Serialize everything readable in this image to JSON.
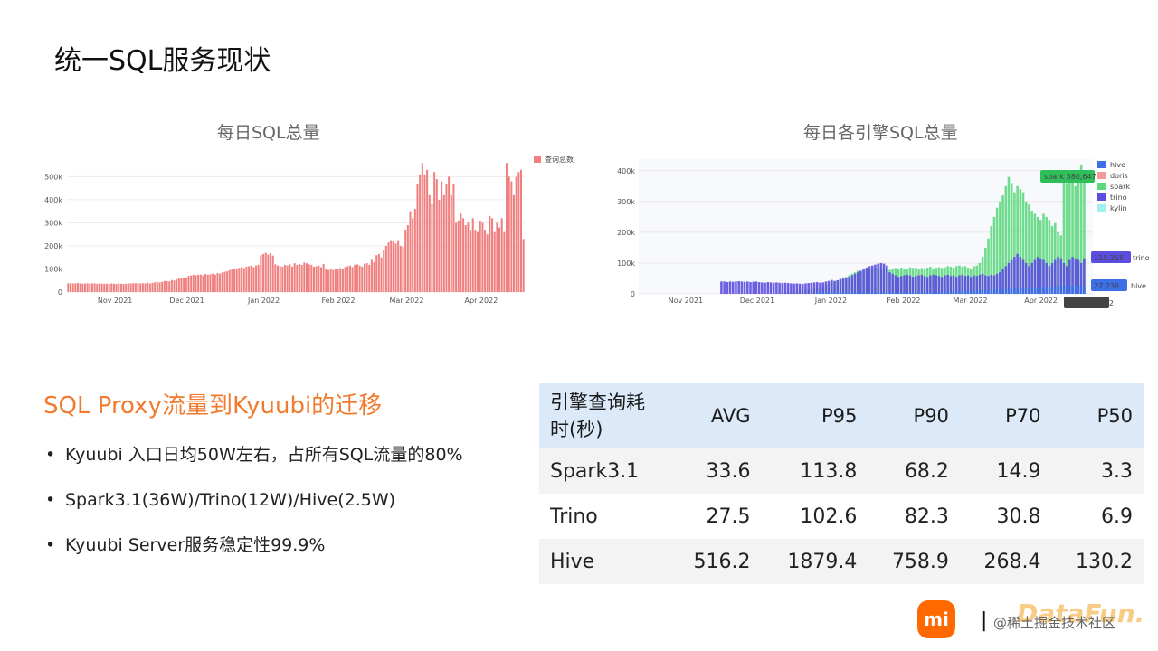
{
  "slide_title": "统一SQL服务现状",
  "chart_data": [
    {
      "type": "bar",
      "title": "每日SQL总量",
      "legend": [
        "查询总数"
      ],
      "legend_position": "top-right",
      "x_tick_labels": [
        "Nov 2021",
        "Dec 2021",
        "Jan 2022",
        "Feb 2022",
        "Mar 2022",
        "Apr 2022"
      ],
      "y_tick_labels": [
        "0",
        "100k",
        "200k",
        "300k",
        "400k",
        "500k"
      ],
      "ylim": [
        0,
        580000
      ],
      "colors": {
        "bars": "#f08080"
      },
      "series": [
        {
          "values": [
            38000,
            38000,
            37000,
            38000,
            39000,
            38000,
            36000,
            37000,
            38000,
            37000,
            37000,
            38000,
            36000,
            37000,
            37000,
            36000,
            36000,
            35000,
            37000,
            36000,
            35000,
            38000,
            36000,
            35000,
            36000,
            38000,
            37000,
            38000,
            38000,
            39000,
            37000,
            38000,
            38000,
            40000,
            37000,
            40000,
            42000,
            45000,
            42000,
            44000,
            48000,
            47000,
            46000,
            52000,
            50000,
            55000,
            60000,
            62000,
            60000,
            63000,
            70000,
            72000,
            75000,
            72000,
            75000,
            76000,
            72000,
            78000,
            75000,
            77000,
            80000,
            75000,
            82000,
            80000,
            85000,
            88000,
            90000,
            95000,
            97000,
            100000,
            102000,
            105000,
            108000,
            104000,
            110000,
            112000,
            115000,
            108000,
            115000,
            118000,
            160000,
            165000,
            170000,
            162000,
            168000,
            158000,
            120000,
            115000,
            112000,
            110000,
            118000,
            115000,
            120000,
            110000,
            125000,
            118000,
            122000,
            118000,
            128000,
            125000,
            120000,
            118000,
            110000,
            112000,
            115000,
            108000,
            122000,
            100000,
            95000,
            98000,
            96000,
            98000,
            100000,
            104000,
            100000,
            108000,
            112000,
            115000,
            108000,
            118000,
            120000,
            115000,
            110000,
            122000,
            125000,
            118000,
            140000,
            130000,
            160000,
            165000,
            150000,
            180000,
            200000,
            215000,
            225000,
            220000,
            210000,
            225000,
            200000,
            195000,
            270000,
            290000,
            350000,
            320000,
            360000,
            470000,
            510000,
            560000,
            510000,
            530000,
            420000,
            380000,
            520000,
            490000,
            400000,
            480000,
            420000,
            470000,
            500000,
            420000,
            470000,
            300000,
            310000,
            340000,
            320000,
            290000,
            300000,
            270000,
            320000,
            270000,
            260000,
            310000,
            300000,
            270000,
            250000,
            330000,
            320000,
            260000,
            300000,
            280000,
            320000,
            260000,
            560000,
            500000,
            480000,
            420000,
            500000,
            520000,
            530000,
            230000
          ]
        }
      ]
    },
    {
      "type": "bar",
      "title": "每日各引擎SQL总量",
      "legend": [
        "hive",
        "doris",
        "spark",
        "trino",
        "kylin"
      ],
      "legend_position": "top-right",
      "x_tick_labels": [
        "Nov 2021",
        "Dec 2021",
        "Jan 2022",
        "Feb 2022",
        "Mar 2022",
        "Apr 2022"
      ],
      "y_tick_labels": [
        "0",
        "100k",
        "200k",
        "300k",
        "400k"
      ],
      "ylim": [
        0,
        420000
      ],
      "colors": {
        "hive": "#3d6fe6",
        "doris": "#f49a9a",
        "spark": "#5ed87f",
        "trino": "#5b4de0",
        "kylin": "#9ff0f0"
      },
      "hover_labels": [
        {
          "series": "spark",
          "value": "380,647",
          "date": "Apr 18, 2022"
        },
        {
          "series": "trino",
          "value": "115,255"
        },
        {
          "series": "hive",
          "value": "27,236"
        }
      ],
      "series": [
        {
          "name": "spark",
          "values": [
            0,
            0,
            0,
            0,
            0,
            0,
            0,
            0,
            0,
            0,
            0,
            0,
            0,
            0,
            0,
            0,
            0,
            0,
            0,
            0,
            0,
            0,
            0,
            0,
            0,
            0,
            0,
            0,
            0,
            0,
            0,
            0,
            0,
            0,
            0,
            0,
            0,
            0,
            0,
            0,
            0,
            0,
            0,
            0,
            0,
            0,
            0,
            0,
            2000,
            3000,
            4000,
            5000,
            5000,
            6000,
            8000,
            10000,
            10000,
            12000,
            13000,
            15000,
            16000,
            18000,
            20000,
            25000,
            30000,
            32000,
            35000,
            40000,
            42000,
            45000,
            48000,
            55000,
            60000,
            65000,
            70000,
            75000,
            72000,
            75000,
            78000,
            80000,
            82000,
            84000,
            82000,
            80000,
            85000,
            82000,
            78000,
            80000,
            84000,
            82000,
            85000,
            82000,
            80000,
            86000,
            84000,
            85000,
            82000,
            84000,
            80000,
            85000,
            88000,
            82000,
            85000,
            86000,
            84000,
            86000,
            90000,
            88000,
            85000,
            90000,
            92000,
            88000,
            90000,
            85000,
            82000,
            90000,
            92000,
            100000,
            120000,
            150000,
            180000,
            220000,
            250000,
            280000,
            300000,
            320000,
            350000,
            380000,
            360000,
            330000,
            350000,
            340000,
            330000,
            300000,
            290000,
            270000,
            260000,
            250000,
            240000,
            260000,
            250000,
            240000,
            220000,
            230000,
            200000,
            190000,
            380647,
            360000,
            370000,
            380000,
            350000,
            400000,
            420000,
            370000
          ]
        },
        {
          "name": "trino",
          "values": [
            40000,
            40000,
            38000,
            40000,
            39000,
            40000,
            41000,
            40000,
            39000,
            40000,
            38000,
            39000,
            40000,
            38000,
            37000,
            36000,
            38000,
            37000,
            36000,
            37000,
            36000,
            35000,
            36000,
            35000,
            34000,
            33000,
            34000,
            33000,
            32000,
            34000,
            35000,
            36000,
            37000,
            38000,
            36000,
            37000,
            40000,
            42000,
            45000,
            42000,
            44000,
            48000,
            50000,
            52000,
            55000,
            60000,
            65000,
            70000,
            75000,
            80000,
            85000,
            90000,
            92000,
            95000,
            98000,
            100000,
            98000,
            92000,
            70000,
            65000,
            60000,
            55000,
            58000,
            60000,
            62000,
            60000,
            55000,
            58000,
            60000,
            62000,
            58000,
            55000,
            60000,
            62000,
            60000,
            58000,
            55000,
            60000,
            62000,
            58000,
            60000,
            55000,
            60000,
            62000,
            58000,
            60000,
            55000,
            60000,
            58000,
            62000,
            65000,
            60000,
            58000,
            62000,
            60000,
            65000,
            70000,
            80000,
            90000,
            100000,
            110000,
            120000,
            130000,
            120000,
            110000,
            100000,
            90000,
            100000,
            110000,
            120000,
            115000,
            110000,
            100000,
            90000,
            100000,
            110000,
            120000,
            115255,
            100000,
            90000,
            110000,
            120000,
            115000,
            110000,
            100000,
            115255
          ]
        },
        {
          "name": "hive",
          "values": [
            5000,
            5000,
            5000,
            5000,
            5000,
            5000,
            5000,
            5000,
            5000,
            5000,
            5000,
            5000,
            5000,
            5000,
            5000,
            5000,
            5000,
            5000,
            5000,
            5000,
            5000,
            5000,
            5000,
            5000,
            5000,
            5000,
            5000,
            5000,
            5000,
            5000,
            5000,
            5000,
            5000,
            5000,
            5000,
            5000,
            5000,
            5000,
            5000,
            5000,
            6000,
            6000,
            6000,
            6000,
            7000,
            7000,
            7000,
            8000,
            8000,
            8000,
            9000,
            9000,
            10000,
            10000,
            10000,
            11000,
            11000,
            12000,
            12000,
            13000,
            13000,
            14000,
            14000,
            15000,
            15000,
            16000,
            16000,
            17000,
            17000,
            18000,
            18000,
            19000,
            19000,
            20000,
            20000,
            21000,
            21000,
            22000,
            22000,
            23000,
            23000,
            24000,
            24000,
            25000,
            25000,
            26000,
            26000,
            27000,
            27000,
            27236,
            27000,
            27000,
            27236
          ]
        }
      ]
    }
  ],
  "section_title": "SQL Proxy流量到Kyuubi的迁移",
  "bullets": [
    "Kyuubi 入口日均50W左右，占所有SQL流量的80%",
    "Spark3.1(36W)/Trino(12W)/Hive(2.5W)",
    "Kyuubi Server服务稳定性99.9%"
  ],
  "table": {
    "headers": [
      "引擎查询耗时(秒)",
      "AVG",
      "P95",
      "P90",
      "P70",
      "P50"
    ],
    "rows": [
      [
        "Spark3.1",
        "33.6",
        "113.8",
        "68.2",
        "14.9",
        "3.3"
      ],
      [
        "Trino",
        "27.5",
        "102.6",
        "82.3",
        "30.8",
        "6.9"
      ],
      [
        "Hive",
        "516.2",
        "1879.4",
        "758.9",
        "268.4",
        "130.2"
      ]
    ]
  },
  "footer": {
    "logo_text": "mi",
    "brand": "DataFun.",
    "watermark": "@稀土掘金技术社区"
  }
}
